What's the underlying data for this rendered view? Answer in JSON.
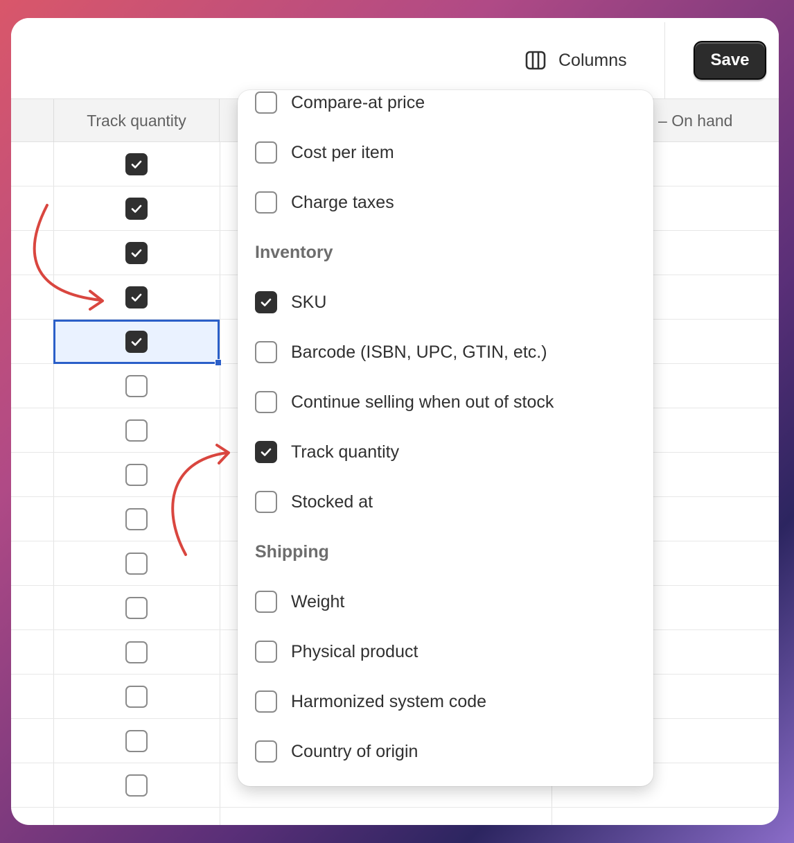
{
  "toolbar": {
    "columns_label": "Columns",
    "columns_icon": "columns-icon",
    "save_label": "Save"
  },
  "table": {
    "headers": {
      "track_quantity": "Track quantity",
      "on_hand": ") – On hand"
    },
    "track_quantity_rows": [
      true,
      true,
      true,
      true,
      true,
      false,
      false,
      false,
      false,
      false,
      false,
      false,
      false,
      false,
      false
    ],
    "selected_row_index": 4
  },
  "columns_menu": {
    "items_top": [
      {
        "label": "Compare-at price",
        "checked": false
      },
      {
        "label": "Cost per item",
        "checked": false
      },
      {
        "label": "Charge taxes",
        "checked": false
      }
    ],
    "section_inventory": "Inventory",
    "items_inventory": [
      {
        "label": "SKU",
        "checked": true
      },
      {
        "label": "Barcode (ISBN, UPC, GTIN, etc.)",
        "checked": false
      },
      {
        "label": "Continue selling when out of stock",
        "checked": false
      },
      {
        "label": "Track quantity",
        "checked": true
      },
      {
        "label": "Stocked at",
        "checked": false
      }
    ],
    "section_shipping": "Shipping",
    "items_shipping": [
      {
        "label": "Weight",
        "checked": false
      },
      {
        "label": "Physical product",
        "checked": false
      },
      {
        "label": "Harmonized system code",
        "checked": false
      },
      {
        "label": "Country of origin",
        "checked": false
      }
    ]
  },
  "colors": {
    "accent_selection": "#2b5fc8",
    "annotation_arrow": "#d9463f",
    "checkbox_checked": "#303030"
  }
}
